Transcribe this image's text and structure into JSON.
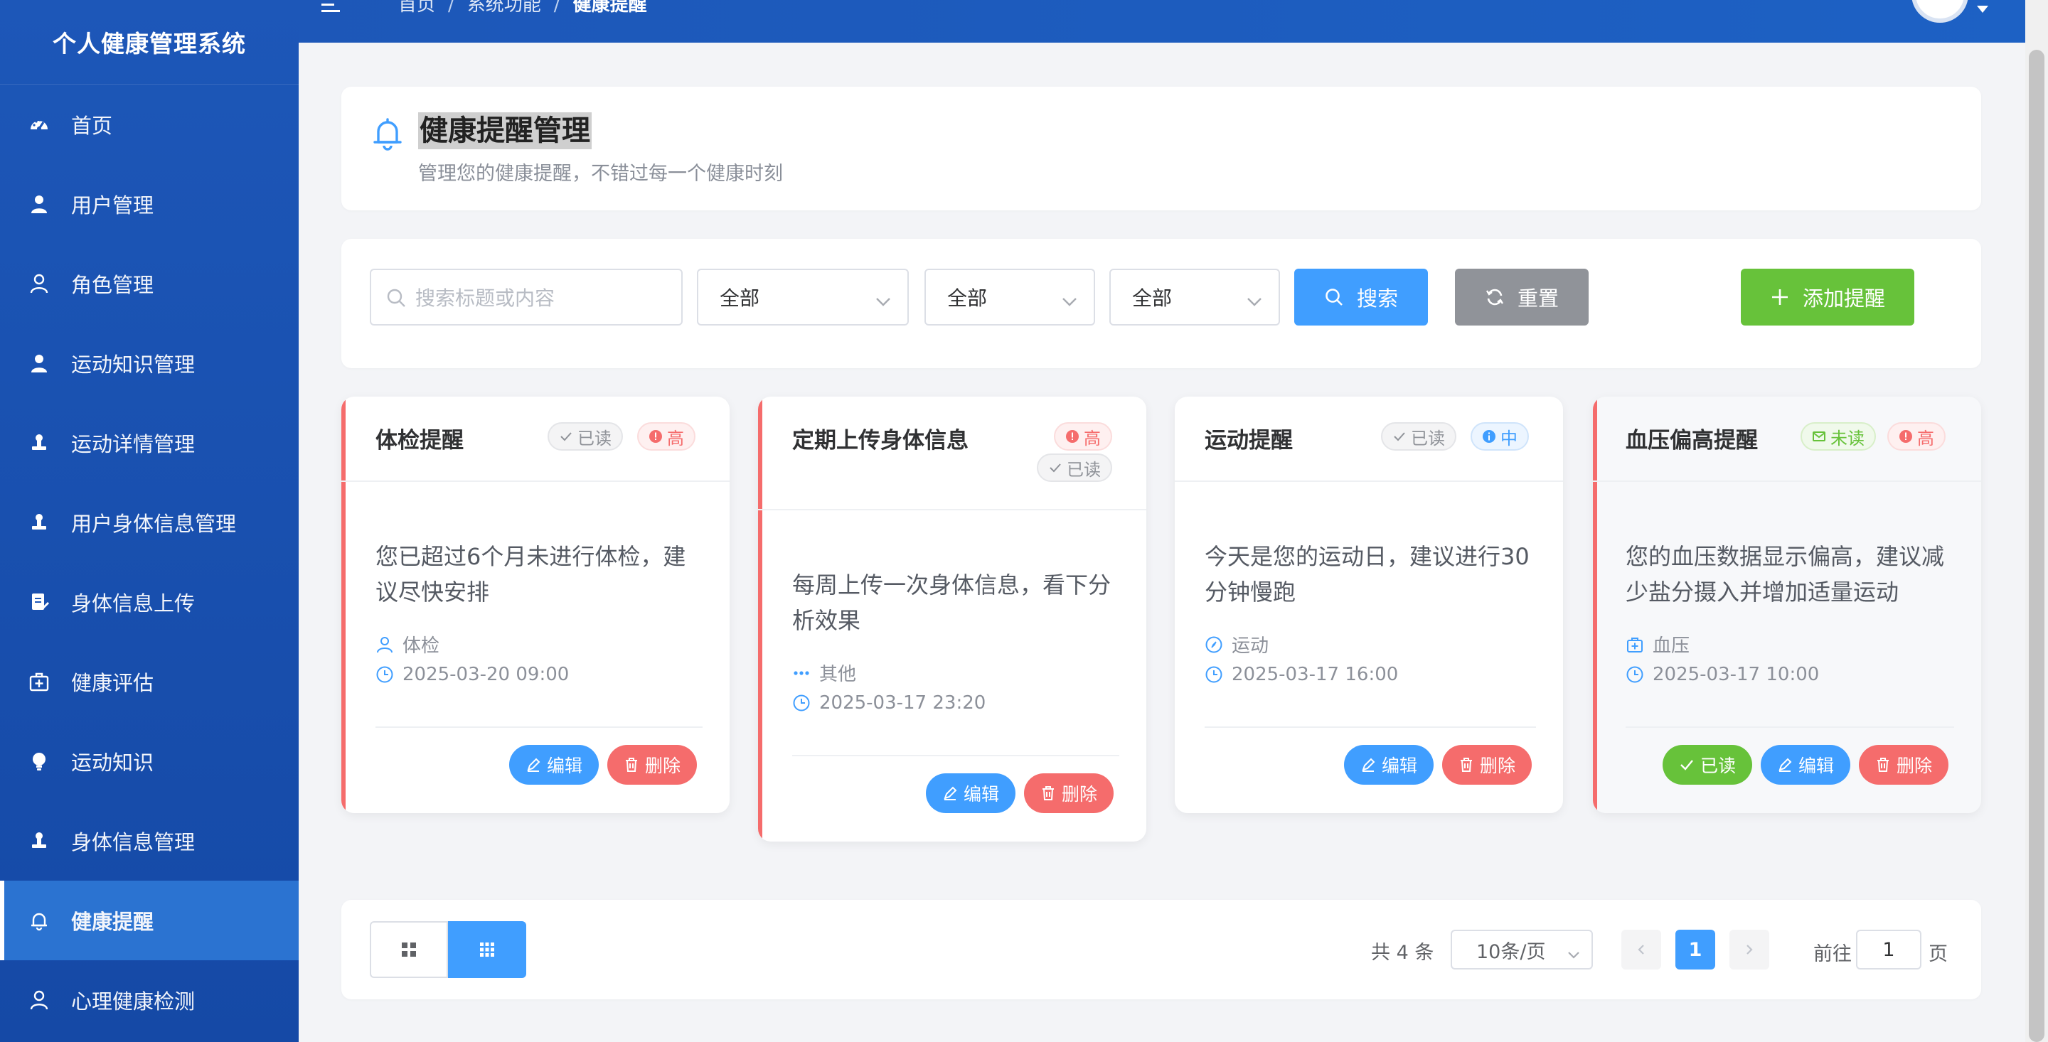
{
  "app": {
    "title": "个人健康管理系统"
  },
  "sidebar": {
    "items": [
      {
        "label": "首页",
        "icon": "dashboard-icon"
      },
      {
        "label": "用户管理",
        "icon": "user-solid-icon"
      },
      {
        "label": "角色管理",
        "icon": "user-outline-icon"
      },
      {
        "label": "运动知识管理",
        "icon": "user-solid-icon"
      },
      {
        "label": "运动详情管理",
        "icon": "stamp-icon"
      },
      {
        "label": "用户身体信息管理",
        "icon": "stamp-icon"
      },
      {
        "label": "身体信息上传",
        "icon": "document-icon"
      },
      {
        "label": "健康评估",
        "icon": "first-aid-icon"
      },
      {
        "label": "运动知识",
        "icon": "bulb-icon"
      },
      {
        "label": "身体信息管理",
        "icon": "stamp-icon"
      },
      {
        "label": "健康提醒",
        "icon": "bell-icon",
        "active": true
      },
      {
        "label": "心理健康检测",
        "icon": "user-outline-icon"
      }
    ]
  },
  "header": {
    "breadcrumb": [
      "首页",
      "系统功能",
      "健康提醒"
    ],
    "separator": "/"
  },
  "page": {
    "title": "健康提醒管理",
    "subtitle": "管理您的健康提醒，不错过每一个健康时刻"
  },
  "filters": {
    "search_placeholder": "搜索标题或内容",
    "select1": "全部",
    "select2": "全部",
    "select3": "全部",
    "search_label": "搜索",
    "reset_label": "重置",
    "add_label": "添加提醒"
  },
  "cards": [
    {
      "title": "体检提醒",
      "status_tag": "已读",
      "priority_tag": "高",
      "content": [
        "您已超过6个月未进行体检，建",
        "议尽快安排"
      ],
      "category": "体检",
      "time": "2025-03-20 09:00",
      "edit_label": "编辑",
      "delete_label": "删除"
    },
    {
      "title": "定期上传身体信息",
      "status_tag": "已读",
      "priority_tag": "高",
      "content": [
        "每周上传一次身体信息，看下分",
        "析效果"
      ],
      "category": "其他",
      "time": "2025-03-17 23:20",
      "edit_label": "编辑",
      "delete_label": "删除"
    },
    {
      "title": "运动提醒",
      "status_tag": "已读",
      "priority_tag": "中",
      "content": [
        "今天是您的运动日，建议进行30",
        "分钟慢跑"
      ],
      "category": "运动",
      "time": "2025-03-17 16:00",
      "edit_label": "编辑",
      "delete_label": "删除"
    },
    {
      "title": "血压偏高提醒",
      "status_tag": "未读",
      "priority_tag": "高",
      "content": [
        "您的血压数据显示偏高，建议减",
        "少盐分摄入并增加适量运动"
      ],
      "category": "血压",
      "time": "2025-03-17 10:00",
      "read_label": "已读",
      "edit_label": "编辑",
      "delete_label": "删除"
    }
  ],
  "pagination": {
    "total": "共 4 条",
    "page_size": "10条/页",
    "current": "1",
    "goto_label": "前往",
    "goto_value": "1",
    "goto_unit": "页"
  },
  "colors": {
    "sidebar": "#1d57b8",
    "primary": "#409eff",
    "success": "#67c23a",
    "danger": "#f56c6c",
    "info": "#909399"
  }
}
